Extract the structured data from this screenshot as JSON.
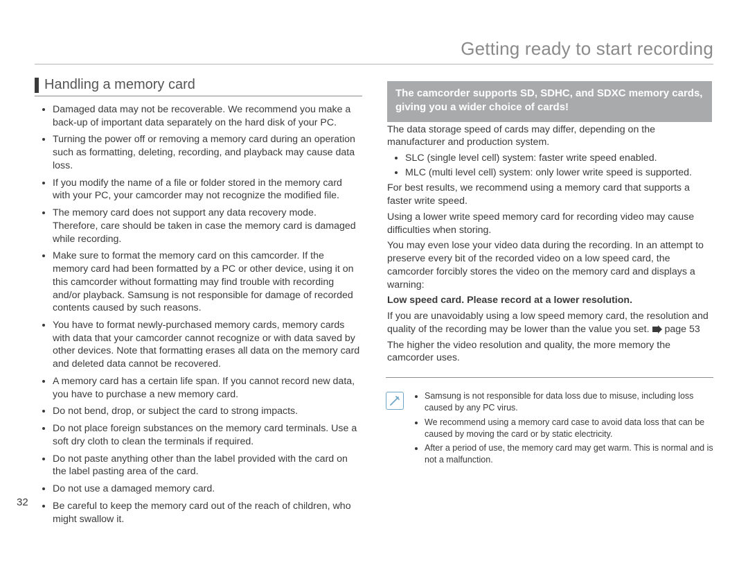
{
  "chapter_title": "Getting ready to start recording",
  "page_number": "32",
  "left": {
    "section_title": "Handling a memory card",
    "items": [
      "Damaged data may not be recoverable. We recommend you make a back-up of important data separately on the hard disk of your PC.",
      "Turning the power off or removing a memory card during an operation such as formatting, deleting, recording, and playback may cause data loss.",
      "If you modify the name of a file or folder stored in the memory card with your PC, your camcorder may not recognize the modified file.",
      "The memory card does not support any data recovery mode. Therefore, care should be taken in case the memory card is damaged while recording.",
      "Make sure to format the memory card on this camcorder. If the memory card had been formatted by a PC or other device, using it on this camcorder without formatting may find trouble with recording and/or playback. Samsung is not responsible for damage of recorded contents caused by such reasons.",
      "You have to format newly-purchased memory cards, memory cards with data that your camcorder cannot recognize or with data saved by other devices. Note that formatting erases all data on the memory card and deleted data cannot be recovered.",
      "A memory card has a certain life span. If you cannot record new data, you have to purchase a new memory card.",
      "Do not bend, drop, or subject the card to strong impacts.",
      "Do not place foreign substances on the memory card terminals. Use a soft dry cloth to clean the terminals if required.",
      "Do not paste anything other than the label provided with the card on the label pasting area of the card.",
      "Do not use a damaged memory card.",
      "Be careful to keep the memory card out of the reach of children, who might swallow it."
    ]
  },
  "right": {
    "banner": "The camcorder supports SD, SDHC, and SDXC memory cards, giving you a wider choice of cards!",
    "p_intro": "The data storage speed of cards may differ, depending on the manufacturer and production system.",
    "cell_items": [
      "SLC (single level cell) system: faster write speed enabled.",
      "MLC (multi level cell) system: only lower write speed is supported."
    ],
    "p_best": "For best results, we recommend using a memory card that supports a faster write speed.",
    "p_lowspeed": "Using a lower write speed memory card for recording video may cause difficulties when storing.",
    "p_lose": "You may even lose your video data during the recording. In an attempt to preserve every bit of the recorded video on a low speed card, the camcorder forcibly stores the video on the memory card and displays a warning:",
    "warning_bold": "Low speed card. Please record at a lower resolution.",
    "p_unavoid_a": "If you are unavoidably using a low speed memory card, the resolution and quality of the recording may be lower than the value you set. ",
    "p_unavoid_b": "page 53",
    "p_higher": "The higher the video resolution and quality, the more memory the camcorder uses.",
    "notes": [
      "Samsung is not responsible for data loss due to misuse, including loss caused by any PC virus.",
      "We recommend using a memory card case to avoid data loss that can be caused by moving the card or by static electricity.",
      "After a period of use, the memory card may get warm. This is normal and is not a malfunction."
    ]
  }
}
